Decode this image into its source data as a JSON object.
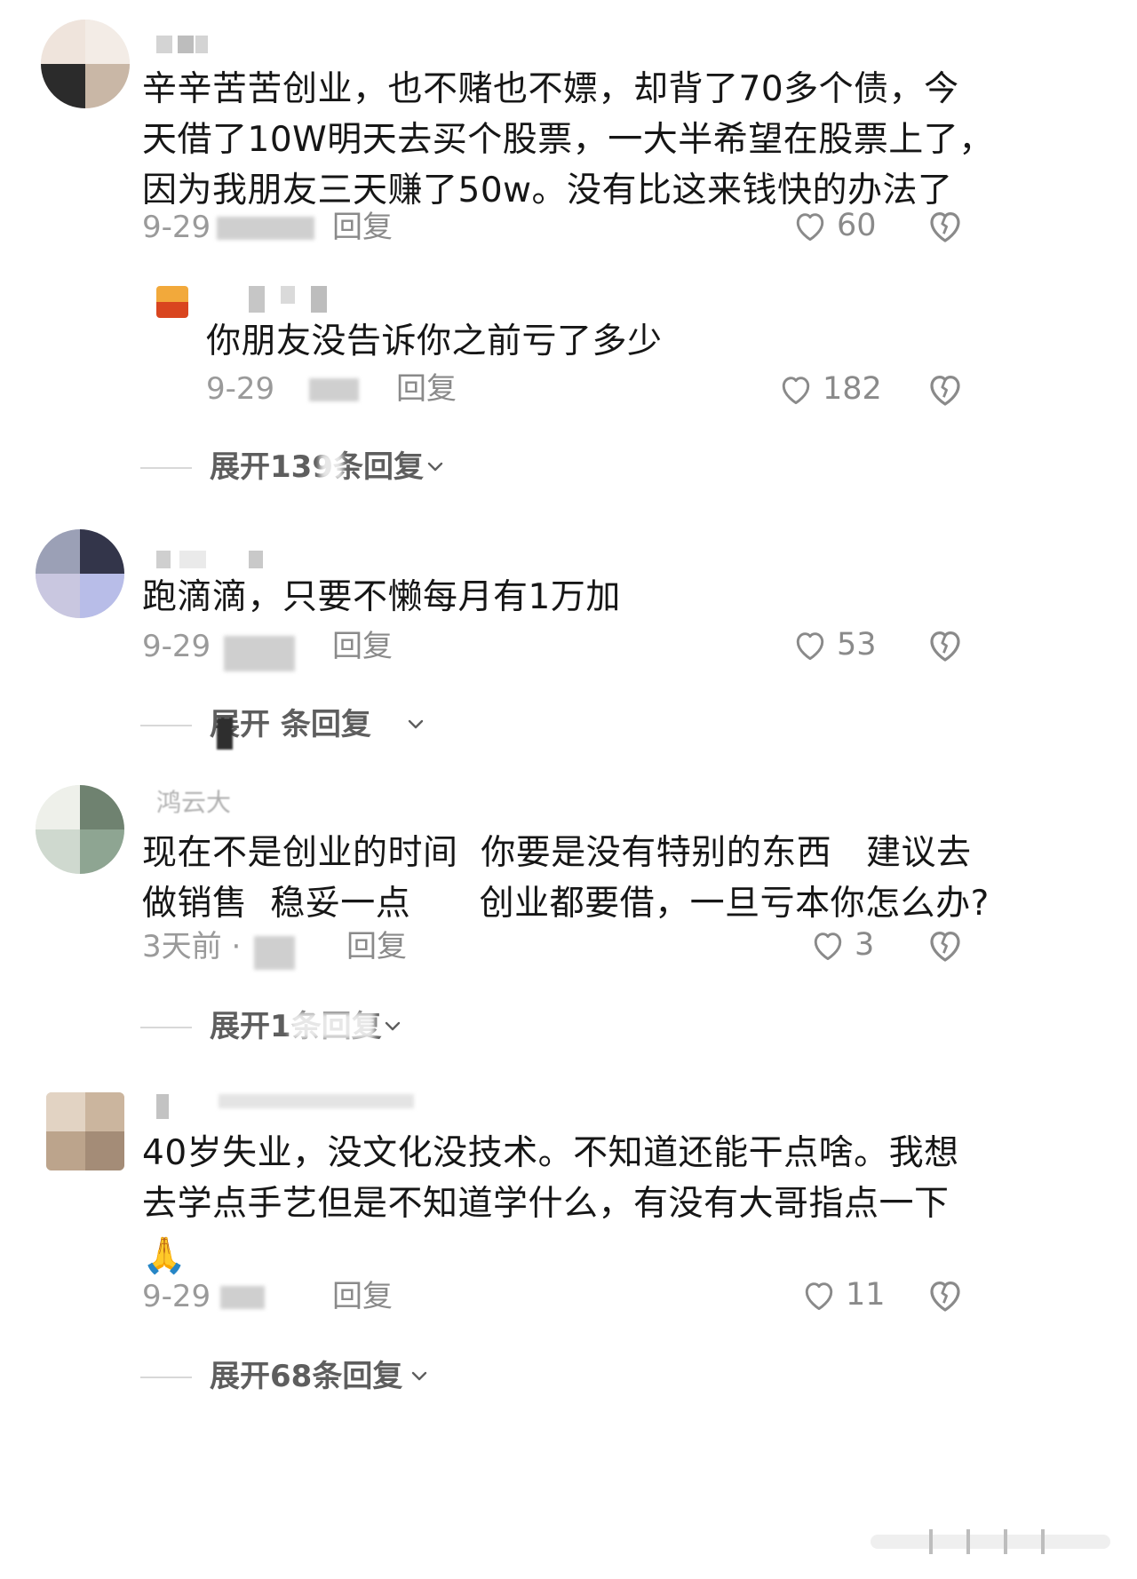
{
  "comments": [
    {
      "text_lines": [
        "辛辛苦苦创业，也不赌也不嫖，却背了70多个债，今",
        "天借了10W明天去买个股票，一大半希望在股票上了，",
        "因为我朋友三天赚了50w。没有比这来钱快的办法了"
      ],
      "date": "9-29",
      "reply_label": "回复",
      "likes": "60"
    },
    {
      "text_lines": [
        "你朋友没告诉你之前亏了多少"
      ],
      "date": "9-29",
      "reply_label": "回复",
      "likes": "182"
    },
    {
      "text_lines": [
        "跑滴滴，只要不懒每月有1万加"
      ],
      "date": "9-29",
      "reply_label": "回复",
      "likes": "53"
    },
    {
      "name": "鸿云大",
      "text_lines": [
        "现在不是创业的时间  你要是没有特别的东西   建议去",
        "做销售  稳妥一点      创业都要借，一旦亏本你怎么办?"
      ],
      "date": "3天前 ·",
      "reply_label": "回复",
      "likes": "3"
    },
    {
      "text_lines": [
        "40岁失业，没文化没技术。不知道还能干点啥。我想",
        "去学点手艺但是不知道学什么，有没有大哥指点一下"
      ],
      "emoji": "🙏",
      "date": "9-29",
      "reply_label": "回复",
      "likes": "11"
    }
  ],
  "expands": [
    {
      "label": "展开139条回复"
    },
    {
      "label": "展开 条回复"
    },
    {
      "label": "展开1条回复"
    },
    {
      "label": "展开68条回复"
    }
  ],
  "icons": {
    "like": "heart-outline-icon",
    "dislike": "broken-heart-icon",
    "expand": "chevron-down-icon"
  },
  "colors": {
    "text": "#161616",
    "meta": "#9a9a9a",
    "expand": "#5e5e5e"
  }
}
